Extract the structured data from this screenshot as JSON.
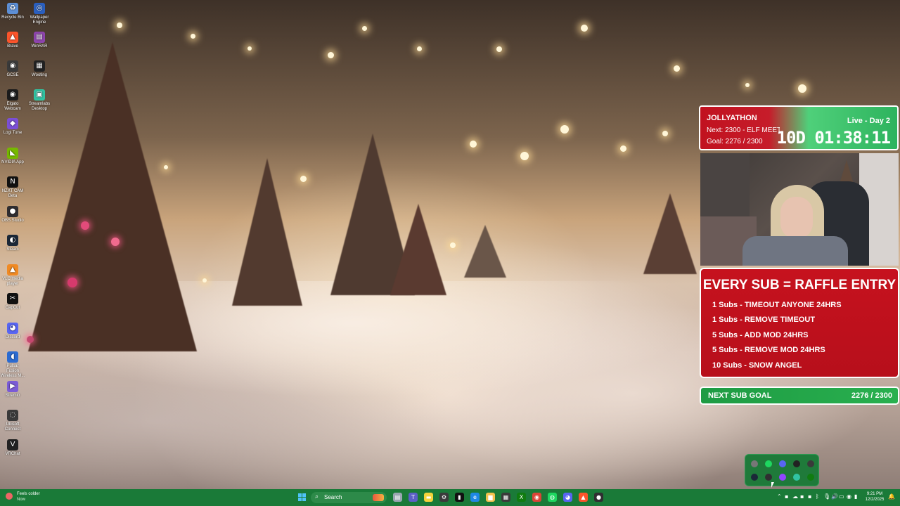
{
  "desktop_icons": [
    {
      "label": "Recycle Bin",
      "icon": "recycle-bin-icon",
      "color": "#5d8fd6"
    },
    {
      "label": "Wallpaper Engine",
      "icon": "wallpaper-engine-icon",
      "color": "#2a5fbf"
    },
    {
      "label": "Brave",
      "icon": "brave-icon",
      "color": "#fb542b"
    },
    {
      "label": "WinRAR",
      "icon": "winrar-icon",
      "color": "#8e44ad"
    },
    {
      "label": "GCSE",
      "icon": "gcse-icon",
      "color": "#3a3a3a"
    },
    {
      "label": "Wooting",
      "icon": "wooting-icon",
      "color": "#222222"
    },
    {
      "label": "Elgato Webcam",
      "icon": "camera-icon",
      "color": "#1c1c1c"
    },
    {
      "label": "Streamlabs Desktop",
      "icon": "streamlabs-icon",
      "color": "#31c3a2"
    },
    {
      "label": "Logi Tune",
      "icon": "logi-tune-icon",
      "color": "#7b4fd6"
    },
    {
      "label": "NVIDIA App",
      "icon": "nvidia-icon",
      "color": "#76b900"
    },
    {
      "label": "NZXT CAM Beta",
      "icon": "nzxt-icon",
      "color": "#111111"
    },
    {
      "label": "OBS Studio",
      "icon": "obs-icon",
      "color": "#302e31"
    },
    {
      "label": "Steam",
      "icon": "steam-icon",
      "color": "#1b2838"
    },
    {
      "label": "VLC media player",
      "icon": "vlc-icon",
      "color": "#f08a24"
    },
    {
      "label": "CapCut",
      "icon": "capcut-icon",
      "color": "#111111"
    },
    {
      "label": "Discord",
      "icon": "discord-icon",
      "color": "#5865f2"
    },
    {
      "label": "Pulsar Fusion Wireless M...",
      "icon": "pulsar-icon",
      "color": "#2c6bd1"
    },
    {
      "label": "Stremio",
      "icon": "stremio-icon",
      "color": "#7b5bd6"
    },
    {
      "label": "Ubisoft Connect",
      "icon": "ubisoft-icon",
      "color": "#3a3a3a"
    },
    {
      "label": "VRChat",
      "icon": "vrchat-icon",
      "color": "#222222"
    }
  ],
  "jollyathon": {
    "title": "JOLLYATHON",
    "next": "Next: 2300 - ELF MEETS",
    "goal": "Goal: 2276 / 2300",
    "live": "Live - Day 2",
    "timer": "10D 01:38:11"
  },
  "raffle": {
    "heading": "EVERY SUB = RAFFLE ENTRY",
    "rows": [
      "1 Subs - TIMEOUT ANYONE 24HRS",
      "1 Subs - REMOVE TIMEOUT",
      "5 Subs - ADD MOD 24HRS",
      "5 Subs - REMOVE MOD 24HRS",
      "10 Subs - SNOW ANGEL"
    ]
  },
  "sub_goal": {
    "label": "NEXT SUB GOAL",
    "value": "2276 / 2300",
    "progress_fraction": 0.99
  },
  "taskbar": {
    "weather_line1": "Feels colder",
    "weather_line2": "Now",
    "search_placeholder": "Search",
    "apps": [
      "file-icon",
      "teams-icon",
      "sticky-notes-icon",
      "settings-icon",
      "terminal-icon",
      "edge-icon",
      "file-explorer-icon",
      "store-icon",
      "xbox-icon",
      "chrome-icon",
      "spotify-icon",
      "discord-icon",
      "brave-icon",
      "obs-icon"
    ],
    "tray_icons": [
      "chevron-up-icon",
      "app-tray-icon",
      "onedrive-icon",
      "app-tray-icon-2",
      "app-tray-icon-3",
      "bluetooth-icon",
      "mic-icon",
      "volume-icon",
      "network-icon",
      "speaker-icon",
      "battery-icon"
    ],
    "time": "9:21 PM",
    "date": "12/2/2025",
    "accent": "#1a7a38"
  },
  "overlay_colors": {
    "red": "#c6121e",
    "green": "#29b04f"
  }
}
